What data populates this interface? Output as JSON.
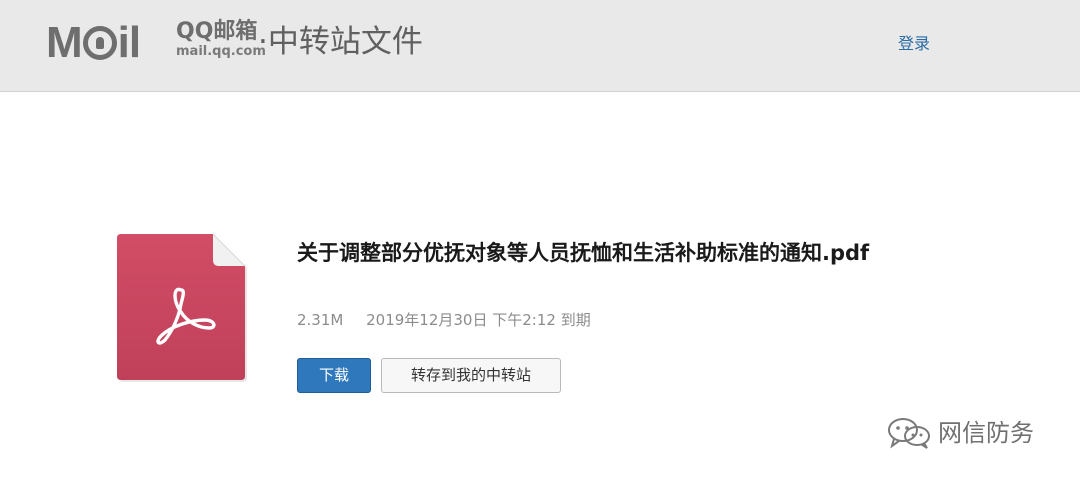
{
  "header": {
    "logo": {
      "brand": "Mail",
      "product": "QQ邮箱",
      "domain": "mail.qq.com",
      "separator_title": "·中转站文件"
    },
    "login_label": "登录"
  },
  "file": {
    "icon": "pdf-file-icon",
    "name": "关于调整部分优抚对象等人员抚恤和生活补助标准的通知.pdf",
    "size": "2.31M",
    "expiry": "2019年12月30日 下午2:12 到期"
  },
  "actions": {
    "download_label": "下载",
    "save_label": "转存到我的中转站"
  },
  "watermark": {
    "icon": "wechat-icon",
    "text": "网信防务"
  },
  "colors": {
    "header_bg": "#e9e9e9",
    "link": "#2a6aa5",
    "primary_button": "#2f78bb",
    "pdf_icon": "#c9475f"
  }
}
